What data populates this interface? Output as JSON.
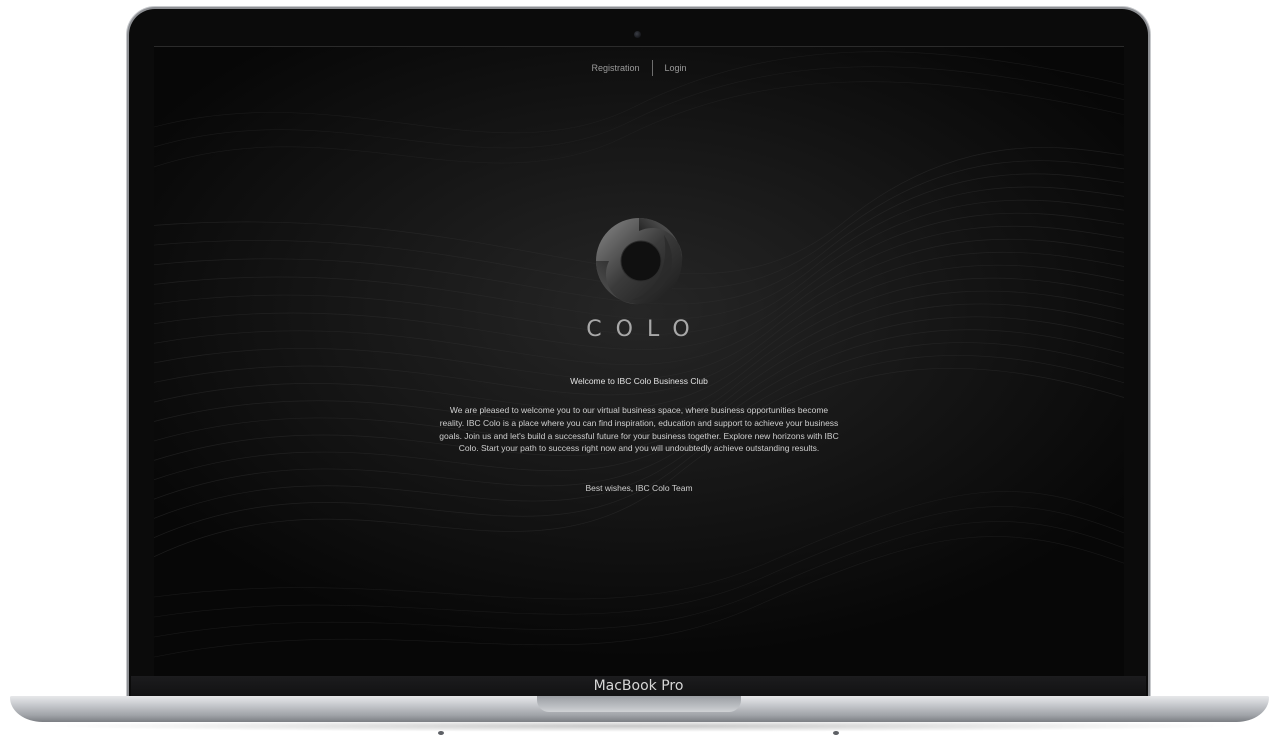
{
  "device": {
    "model_label": "MacBook Pro"
  },
  "nav": {
    "registration_label": "Registration",
    "login_label": "Login"
  },
  "brand": {
    "wordmark": "COLO"
  },
  "content": {
    "welcome_heading": "Welcome to IBC Colo Business Club",
    "body": "We are pleased to welcome you to our virtual business space, where business opportunities become reality. IBC Colo is a place where you can find inspiration, education and support to achieve your business goals. Join us and let's build a successful future for your business together. Explore new horizons with IBC Colo. Start your path to success right now and you will undoubtedly achieve outstanding results.",
    "signoff": "Best wishes, IBC Colo Team"
  },
  "colors": {
    "screen_background": "#151515",
    "text_primary": "#e2e2e2",
    "text_secondary": "#9a9a9a",
    "bezel": "#0b0b0b",
    "chassis": "#cbcdd1"
  }
}
